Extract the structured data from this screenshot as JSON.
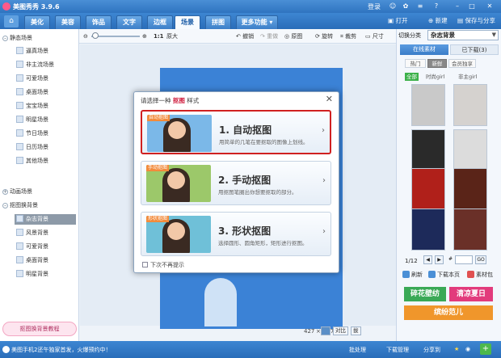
{
  "app": {
    "title": "美图秀秀 3.9.6",
    "login": "登录"
  },
  "nav": {
    "tabs": [
      "美化",
      "美容",
      "饰品",
      "文字",
      "边框",
      "场景",
      "拼图",
      "更多功能 ▾"
    ],
    "active": 5,
    "open": "打开",
    "new": "新建",
    "save_share": "保存与分享"
  },
  "toolbar": {
    "zoom_label": "原大",
    "undo": "撤销",
    "redo": "重做",
    "original": "原图",
    "rotate": "旋转",
    "crop": "裁剪",
    "size": "尺寸",
    "switch_label": "切换分类"
  },
  "left": {
    "groups": [
      "静态场景",
      "动画场景",
      "抠图换背景"
    ],
    "static_items": [
      "逼真场景",
      "非主流场景",
      "可爱场景",
      "桌面场景",
      "宝宝场景",
      "明星场景",
      "节日场景",
      "日历场景",
      "其他场景"
    ],
    "cutout_items": [
      "杂志背景",
      "风景背景",
      "可爱背景",
      "桌面背景",
      "明星背景"
    ],
    "selected": "杂志背景",
    "tutorial": "抠图换背景教程"
  },
  "canvas": {
    "size_w": "427",
    "size_x": "×",
    "size_h": "647",
    "compare": "对比",
    "right_label": "拔"
  },
  "right": {
    "category": "杂志背景",
    "tabs": [
      "在线素材",
      "已下载(3)"
    ],
    "subtabs": [
      "热门",
      "新鲜",
      "会员独享"
    ],
    "tags": [
      "全部",
      "时尚girl",
      "非主girl"
    ],
    "page": "1/12",
    "actions": [
      "刷新",
      "下载本页",
      "素材包"
    ],
    "banners": [
      "碎花壁纺",
      "清凉夏日",
      "缤纷范儿"
    ]
  },
  "dialog": {
    "title_pre": "请选择一种",
    "title_em": "抠图",
    "title_post": "样式",
    "options": [
      {
        "badge": "自动抠图",
        "name": "1. 自动抠图",
        "desc": "用简单的几笔在要抠取的图像上划线。"
      },
      {
        "badge": "手动抠图",
        "name": "2. 手动抠图",
        "desc": "用抠图笔圈出你想要抠取的部分。"
      },
      {
        "badge": "形状抠图",
        "name": "3. 形状抠图",
        "desc": "选择圆形、圆角矩形，矩形进行抠图。"
      }
    ],
    "dont_show": "下次不再提示"
  },
  "status": {
    "msg": "美图手机2还午独家首发，火爆预约中！",
    "batch": "批处理",
    "download": "下载管理",
    "share": "分享到"
  },
  "colors": {
    "accent": "#2f74c0",
    "highlight": "#d02020"
  }
}
